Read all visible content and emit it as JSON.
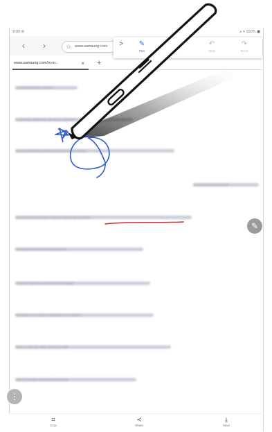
{
  "status_bar": {
    "left": "9:00 ⚙",
    "right": "⊿ ▾ 100% ■"
  },
  "browser": {
    "back_icon": "chevron-left-icon",
    "forward_icon": "chevron-right-icon",
    "url": "www.samsung.com",
    "tab_title": "www.samsung.com/m-m...",
    "tab_close": "×",
    "new_tab": "+"
  },
  "edit_toolbar": {
    "expand": ">",
    "pen_label": "Pen",
    "undo_label": "Undo",
    "redo_label": "Redo"
  },
  "content": {
    "paragraphs": [
      "Lorem ipsum dolor sit amet",
      "Consectetur adipiscing elit sed do eiusmod",
      "Tempor incididunt ut labore et dolore magna aliqua",
      "Ut enim ad minim veniam",
      "Quis nostrud exercitation ullamco laboris nisi ut aliquip",
      "Duis aute irure dolor in reprehenderit",
      "Voluptate velit esse cillum dolore eu fugiat",
      "Excepteur sint occaecat cupidatat non proident",
      "Sunt in culpa qui officia deserunt mollit",
      "Anim id est laborum sed ut perspiciatis",
      "Nemo enim ipsam voluptatem quia voluptas"
    ]
  },
  "bottom_bar": {
    "crop_label": "Crop",
    "share_label": "Share",
    "save_label": "Save"
  },
  "colors": {
    "ink_blue": "#2f5bd0",
    "ink_red": "#d42a2a",
    "accent": "#2d5fd8"
  },
  "icons": {
    "fab": "pencil-icon",
    "more": "more-icon",
    "pen": "s-pen-stylus-icon"
  }
}
